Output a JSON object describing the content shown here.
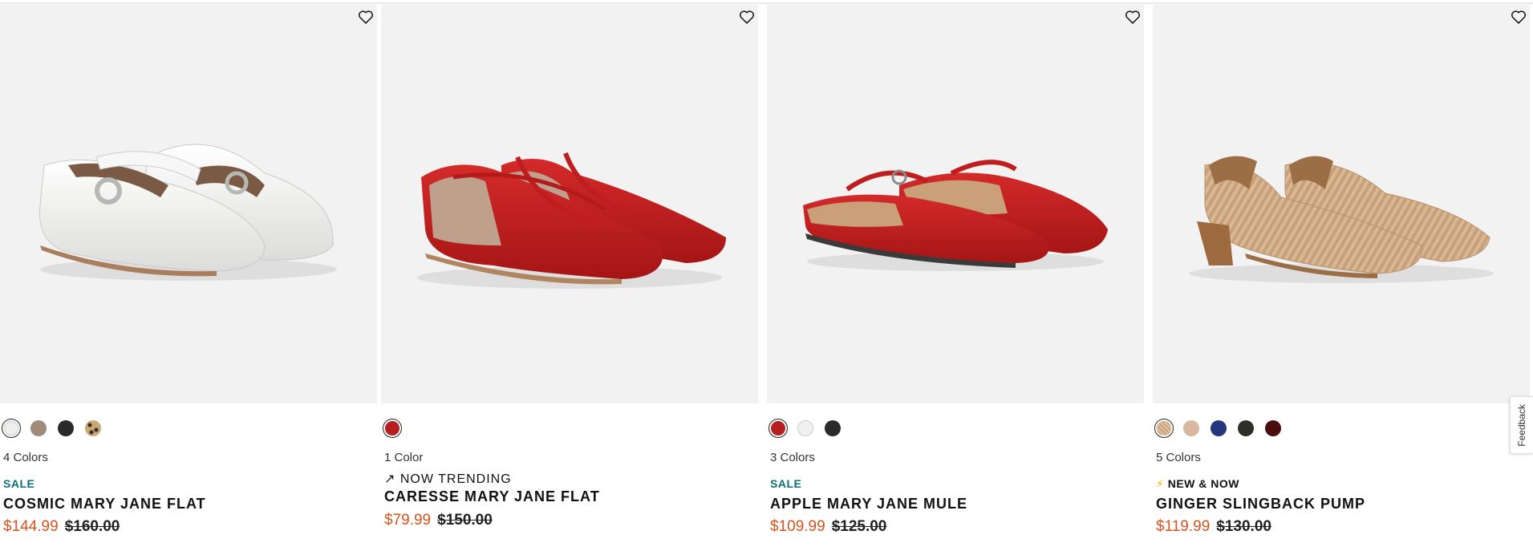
{
  "products": [
    {
      "swatches": [
        "#efefed",
        "#a08a7c",
        "#2a2a2a",
        "leopard"
      ],
      "selected_swatch": 0,
      "colors_label": "4 Colors",
      "badge": "SALE",
      "badge_type": "sale",
      "name": "COSMIC MARY JANE FLAT",
      "sale_price": "$144.99",
      "original_price": "$160.00"
    },
    {
      "swatches": [
        "#b51f1f"
      ],
      "selected_swatch": 0,
      "colors_label": "1 Color",
      "badge": "NOW TRENDING",
      "badge_type": "trend",
      "badge_icon": "trending-arrow-icon",
      "name": "CARESSE MARY JANE FLAT",
      "sale_price": "$79.99",
      "original_price": "$150.00"
    },
    {
      "swatches": [
        "#b51f1f",
        "#f0f0f0",
        "#2a2a2a"
      ],
      "selected_swatch": 0,
      "colors_label": "3 Colors",
      "badge": "SALE",
      "badge_type": "sale",
      "name": "APPLE MARY JANE MULE",
      "sale_price": "$109.99",
      "original_price": "$125.00"
    },
    {
      "swatches": [
        "raffia",
        "#d9b89f",
        "#23387a",
        "#2d2e2a",
        "#4a0e0e"
      ],
      "selected_swatch": 0,
      "colors_label": "5 Colors",
      "badge": "NEW & NOW",
      "badge_type": "new",
      "badge_icon": "lightning-bolt-icon",
      "name": "GINGER SLINGBACK PUMP",
      "sale_price": "$119.99",
      "original_price": "$130.00"
    }
  ],
  "feedback_label": "Feedback",
  "colors": {
    "sale_price": "#d9531e",
    "sale_badge": "#0a6e78",
    "image_bg": "#f2f2f2"
  }
}
